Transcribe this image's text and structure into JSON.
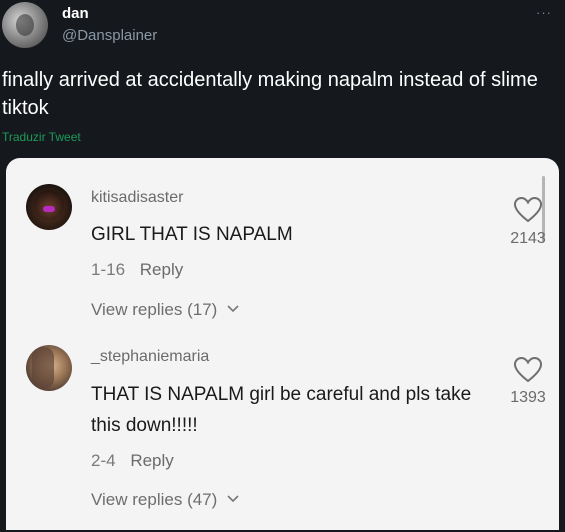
{
  "tweet": {
    "display_name": "dan",
    "handle": "@Dansplainer",
    "text": "finally arrived at accidentally making napalm instead of slime tiktok",
    "translate_label": "Traduzir Tweet",
    "more_icon": "more-horizontal-icon"
  },
  "comments": [
    {
      "username": "kitisadisaster",
      "text": "GIRL THAT IS NAPALM",
      "date": "1-16",
      "reply_label": "Reply",
      "view_replies": "View replies (17)",
      "likes": "2143"
    },
    {
      "username": "_stephaniemaria",
      "text": "THAT IS NAPALM girl be careful and pls take this down!!!!!",
      "date": "2-4",
      "reply_label": "Reply",
      "view_replies": "View replies (47)",
      "likes": "1393"
    }
  ],
  "colors": {
    "background": "#15191d",
    "card": "#f4f4f4",
    "translate": "#1d9a5a",
    "muted": "#6b6b6b"
  }
}
